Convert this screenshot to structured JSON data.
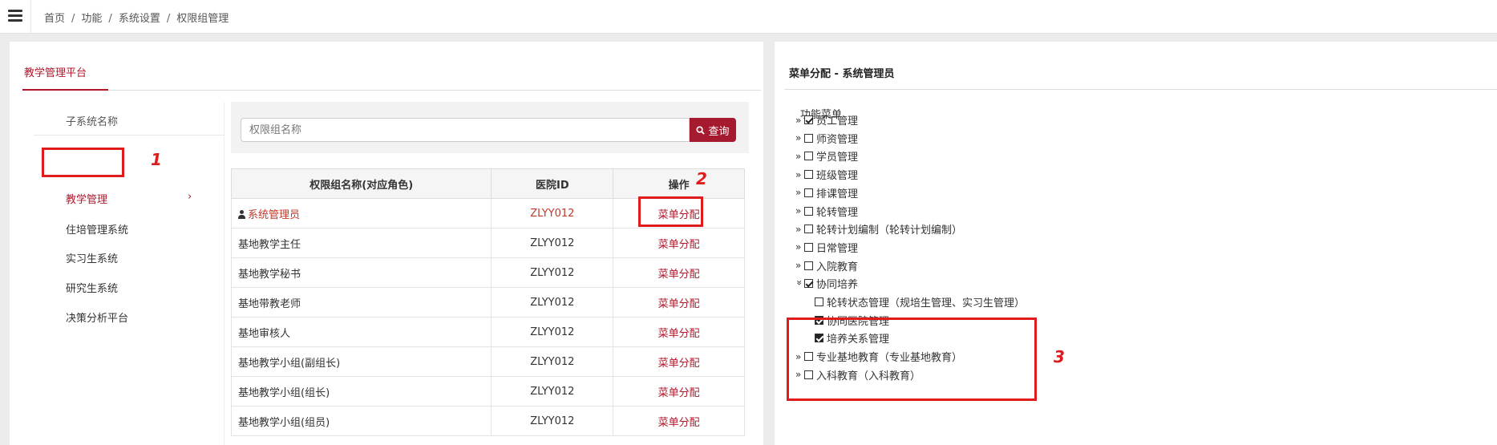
{
  "breadcrumb": [
    "首页",
    "功能",
    "系统设置",
    "权限组管理"
  ],
  "left": {
    "platform_tab": "教学管理平台",
    "subsystem_header": "子系统名称",
    "subsystems": [
      "教学管理",
      "住培管理系统",
      "实习生系统",
      "研究生系统",
      "决策分析平台"
    ],
    "search_placeholder": "权限组名称",
    "search_button": "查询",
    "columns": [
      "权限组名称(对应角色)",
      "医院ID",
      "操作"
    ],
    "rows": [
      {
        "name": "系统管理员",
        "hospital_id": "ZLYY012",
        "action": "菜单分配"
      },
      {
        "name": "基地教学主任",
        "hospital_id": "ZLYY012",
        "action": "菜单分配"
      },
      {
        "name": "基地教学秘书",
        "hospital_id": "ZLYY012",
        "action": "菜单分配"
      },
      {
        "name": "基地带教老师",
        "hospital_id": "ZLYY012",
        "action": "菜单分配"
      },
      {
        "name": "基地审核人",
        "hospital_id": "ZLYY012",
        "action": "菜单分配"
      },
      {
        "name": "基地教学小组(副组长)",
        "hospital_id": "ZLYY012",
        "action": "菜单分配"
      },
      {
        "name": "基地教学小组(组长)",
        "hospital_id": "ZLYY012",
        "action": "菜单分配"
      },
      {
        "name": "基地教学小组(组员)",
        "hospital_id": "ZLYY012",
        "action": "菜单分配"
      }
    ]
  },
  "right": {
    "title": "菜单分配 - 系统管理员",
    "tree_root": "功能菜单",
    "items": [
      {
        "label": "员工管理",
        "checked": true
      },
      {
        "label": "师资管理",
        "checked": false
      },
      {
        "label": "学员管理",
        "checked": false
      },
      {
        "label": "班级管理",
        "checked": false
      },
      {
        "label": "排课管理",
        "checked": false
      },
      {
        "label": "轮转管理",
        "checked": false
      },
      {
        "label": "轮转计划编制（轮转计划编制）",
        "checked": false
      },
      {
        "label": "日常管理",
        "checked": false
      },
      {
        "label": "入院教育",
        "checked": false
      },
      {
        "label": "协同培养",
        "checked": true,
        "expanded": true
      },
      {
        "label": "专业基地教育（专业基地教育）",
        "checked": false
      },
      {
        "label": "入科教育（入科教育）",
        "checked": false
      }
    ],
    "sub_items": [
      {
        "label": "轮转状态管理（规培生管理、实习生管理）",
        "checked": false
      },
      {
        "label": "协同医院管理",
        "checked": true
      },
      {
        "label": "培养关系管理",
        "checked": true
      }
    ]
  },
  "annotations": [
    "1",
    "2",
    "3"
  ],
  "colors": {
    "accent": "#b0182b",
    "annotation": "#e01b1b"
  }
}
